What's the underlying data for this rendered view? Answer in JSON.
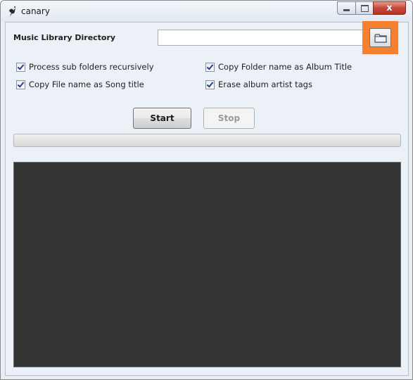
{
  "window": {
    "title": "canary",
    "icon": "canary-bird-icon",
    "close_glyph": "x"
  },
  "form": {
    "library_label": "Music Library Directory",
    "library_value": "",
    "library_placeholder": "",
    "browse_icon": "folder-icon",
    "browse_highlight_color": "#f7802f"
  },
  "options": [
    {
      "label": "Process sub folders recursively",
      "checked": true
    },
    {
      "label": "Copy Folder name as Album Title",
      "checked": true
    },
    {
      "label": "Copy File name as Song title",
      "checked": true
    },
    {
      "label": "Erase album artist tags",
      "checked": true
    }
  ],
  "actions": {
    "start_label": "Start",
    "stop_label": "Stop",
    "stop_enabled": false
  },
  "progress": {
    "fraction": 0
  },
  "log": {
    "text": "",
    "background": "#333333"
  }
}
